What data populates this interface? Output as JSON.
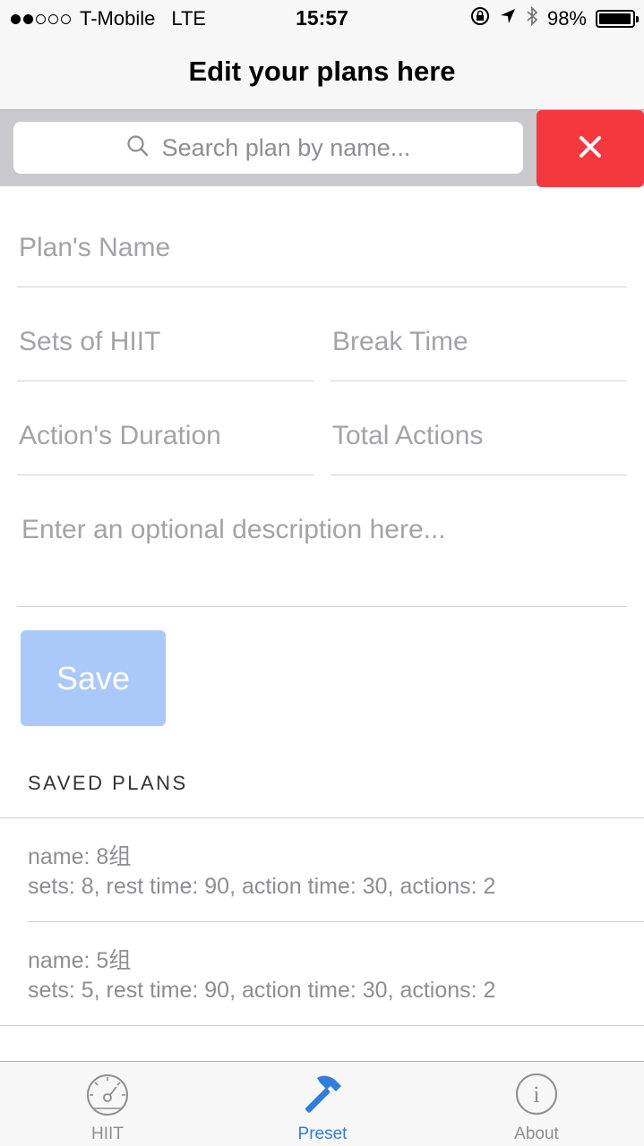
{
  "status_bar": {
    "carrier": "T-Mobile",
    "network": "LTE",
    "time": "15:57",
    "battery": "98%",
    "battery_level": 0.98,
    "signal_bars_filled": 2,
    "signal_bars_total": 5,
    "icons": [
      "orientation-lock-icon",
      "location-arrow-icon",
      "bluetooth-icon",
      "battery-icon"
    ]
  },
  "nav": {
    "title": "Edit your plans here"
  },
  "search": {
    "placeholder": "Search plan by name...",
    "icon": "search-icon",
    "clear_icon": "close-icon"
  },
  "form": {
    "plan_name_placeholder": "Plan's Name",
    "sets_placeholder": "Sets of HIIT",
    "break_placeholder": "Break Time",
    "duration_placeholder": "Action's Duration",
    "total_actions_placeholder": "Total Actions",
    "description_placeholder": "Enter an optional description here...",
    "save_label": "Save"
  },
  "saved_plans": {
    "header": "SAVED PLANS",
    "items": [
      {
        "name": "name: 8组",
        "details": "sets: 8, rest time: 90, action time: 30, actions: 2"
      },
      {
        "name": "name: 5组",
        "details": "sets: 5, rest time: 90, action time: 30, actions: 2"
      }
    ]
  },
  "tabs": [
    {
      "label": "HIIT",
      "icon": "speedometer-icon",
      "active": false
    },
    {
      "label": "Preset",
      "icon": "hammer-icon",
      "active": true
    },
    {
      "label": "About",
      "icon": "info-icon",
      "active": false
    }
  ],
  "colors": {
    "accent": "#2f7ddf",
    "danger": "#f5383d",
    "save_disabled": "#abc9f8",
    "placeholder": "#a3a3a8"
  }
}
